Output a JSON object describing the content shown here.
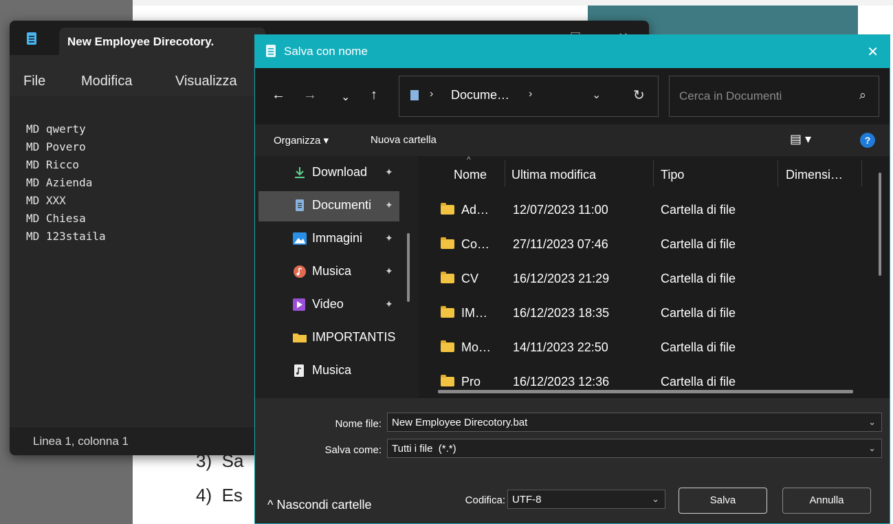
{
  "background": {
    "list_items": [
      {
        "num": "3)",
        "text": "Sa"
      },
      {
        "num": "4)",
        "text": "Es"
      }
    ]
  },
  "notepad": {
    "title": "New Employee Direcotory.",
    "menu": [
      "File",
      "Modifica",
      "Visualizza"
    ],
    "lines": [
      "MD qwerty",
      "MD Povero",
      "MD Ricco",
      "MD Azienda",
      "MD XXX",
      "MD Chiesa",
      "MD 123staila"
    ],
    "status": "Linea 1, colonna 1"
  },
  "dialog": {
    "title": "Salva con nome",
    "address": {
      "folder": "Docume…",
      "sep": "›"
    },
    "search_placeholder": "Cerca in Documenti",
    "toolbar": {
      "organize": "Organizza ▾",
      "new_folder": "Nuova cartella"
    },
    "nav_items": [
      {
        "label": "Download",
        "pinned": true,
        "icon": "download-icon"
      },
      {
        "label": "Documenti",
        "pinned": true,
        "icon": "documents-icon",
        "selected": true
      },
      {
        "label": "Immagini",
        "pinned": true,
        "icon": "pictures-icon"
      },
      {
        "label": "Musica",
        "pinned": true,
        "icon": "music-icon"
      },
      {
        "label": "Video",
        "pinned": true,
        "icon": "video-icon"
      },
      {
        "label": "IMPORTANTIS",
        "pinned": false,
        "icon": "folder-icon"
      },
      {
        "label": "Musica",
        "pinned": false,
        "icon": "music-file-icon"
      }
    ],
    "columns": {
      "name": "Nome",
      "modified": "Ultima modifica",
      "type": "Tipo",
      "size": "Dimensi…"
    },
    "files": [
      {
        "name": "Ad…",
        "modified": "12/07/2023 11:00",
        "type": "Cartella di file"
      },
      {
        "name": "Co…",
        "modified": "27/11/2023 07:46",
        "type": "Cartella di file"
      },
      {
        "name": "CV",
        "modified": "16/12/2023 21:29",
        "type": "Cartella di file"
      },
      {
        "name": "IM…",
        "modified": "16/12/2023 18:35",
        "type": "Cartella di file"
      },
      {
        "name": "Mo…",
        "modified": "14/11/2023 22:50",
        "type": "Cartella di file"
      },
      {
        "name": "Pro",
        "modified": "16/12/2023 12:36",
        "type": "Cartella di file"
      }
    ],
    "form": {
      "filename_label": "Nome file:",
      "filename_value": "New Employee Direcotory.bat",
      "savetype_label": "Salva come:",
      "savetype_value": "Tutti i file  (*.*)",
      "encoding_label": "Codifica:",
      "encoding_value": "UTF-8",
      "save": "Salva",
      "cancel": "Annulla",
      "hide_folders": "Nascondi cartelle"
    },
    "colors": {
      "accent": "#12aebc",
      "folder": "#f2c341",
      "help": "#1f7ad8"
    }
  }
}
